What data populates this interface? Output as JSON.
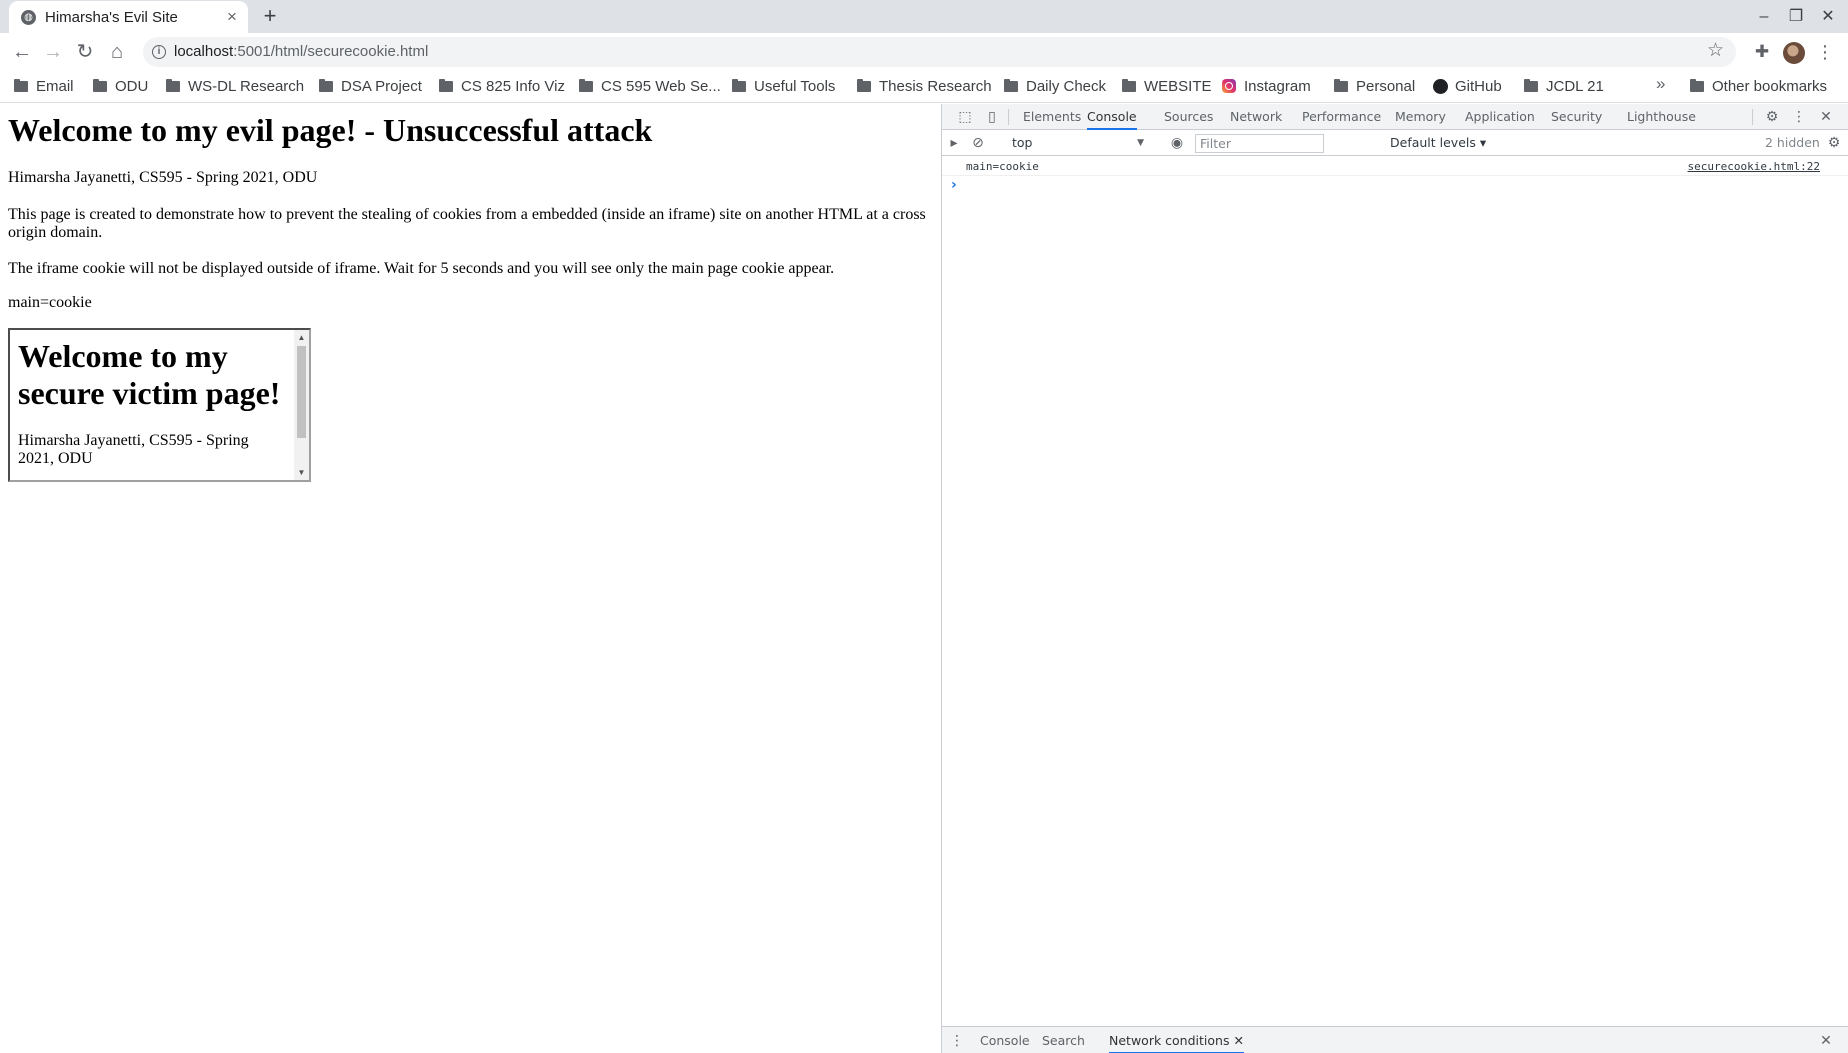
{
  "browser": {
    "tab_title": "Himarsha's Evil Site",
    "url_host": "localhost",
    "url_path": ":5001/html/securecookie.html"
  },
  "bookmarks": [
    {
      "label": "Email",
      "icon": "folder-icon"
    },
    {
      "label": "ODU",
      "icon": "folder-icon"
    },
    {
      "label": "WS-DL Research",
      "icon": "folder-icon"
    },
    {
      "label": "DSA Project",
      "icon": "folder-icon"
    },
    {
      "label": "CS 825 Info Viz",
      "icon": "folder-icon"
    },
    {
      "label": "CS 595 Web Se...",
      "icon": "folder-icon"
    },
    {
      "label": "Useful Tools",
      "icon": "folder-icon"
    },
    {
      "label": "Thesis Research",
      "icon": "folder-icon"
    },
    {
      "label": "Daily Check",
      "icon": "folder-icon"
    },
    {
      "label": "WEBSITE",
      "icon": "folder-icon"
    },
    {
      "label": "Instagram",
      "icon": "instagram-icon"
    },
    {
      "label": "Personal",
      "icon": "folder-icon"
    },
    {
      "label": "GitHub",
      "icon": "github-icon"
    },
    {
      "label": "JCDL 21",
      "icon": "folder-icon"
    },
    {
      "label": "Other bookmarks",
      "icon": "folder-icon"
    }
  ],
  "page": {
    "heading": "Welcome to my evil page! - Unsuccessful attack",
    "author": "Himarsha Jayanetti, CS595 - Spring 2021, ODU",
    "description": "This page is created to demonstrate how to prevent the stealing of cookies from a embedded (inside an iframe) site on another HTML at a cross origin domain.",
    "instruction": "The iframe cookie will not be displayed outside of iframe. Wait for 5 seconds and you will see only the main page cookie appear.",
    "cookie_output": "main=cookie",
    "iframe": {
      "heading": "Welcome to my secure victim page!",
      "author": "Himarsha Jayanetti, CS595 - Spring 2021, ODU"
    }
  },
  "devtools": {
    "tabs": [
      "Elements",
      "Console",
      "Sources",
      "Network",
      "Performance",
      "Memory",
      "Application",
      "Security",
      "Lighthouse"
    ],
    "active_tab": "Console",
    "context": "top",
    "filter_placeholder": "Filter",
    "levels": "Default levels",
    "hidden": "2 hidden",
    "console_message": "main=cookie",
    "console_source": "securecookie.html:22",
    "drawer_tabs": [
      "Console",
      "Search",
      "Network conditions"
    ],
    "drawer_active": "Network conditions"
  },
  "colors": {
    "accent": "#1a73e8",
    "tabstrip": "#dee1e6"
  }
}
